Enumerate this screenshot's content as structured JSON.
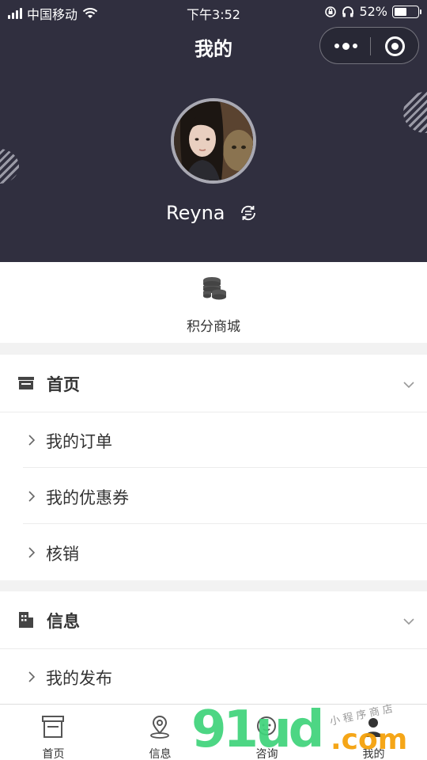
{
  "status_bar": {
    "carrier": "中国移动",
    "time": "下午3:52",
    "battery_percent": "52%",
    "battery_level": 0.52
  },
  "header": {
    "title": "我的",
    "background_color": "#302f3f",
    "user": {
      "name": "Reyna"
    }
  },
  "points_mall": {
    "label": "积分商城"
  },
  "sections": [
    {
      "title": "首页",
      "items": [
        {
          "label": "我的订单"
        },
        {
          "label": "我的优惠券"
        },
        {
          "label": "核销"
        }
      ]
    },
    {
      "title": "信息",
      "items": [
        {
          "label": "我的发布"
        }
      ]
    }
  ],
  "tabbar": {
    "tabs": [
      {
        "label": "首页",
        "icon": "store-icon"
      },
      {
        "label": "信息",
        "icon": "location-pin-icon"
      },
      {
        "label": "咨询",
        "icon": "chat-face-icon"
      },
      {
        "label": "我的",
        "icon": "person-icon"
      }
    ],
    "active_index": 3
  },
  "watermark": {
    "brand": "91ud",
    "suffix": ".com",
    "tagline": "小程序商店"
  }
}
